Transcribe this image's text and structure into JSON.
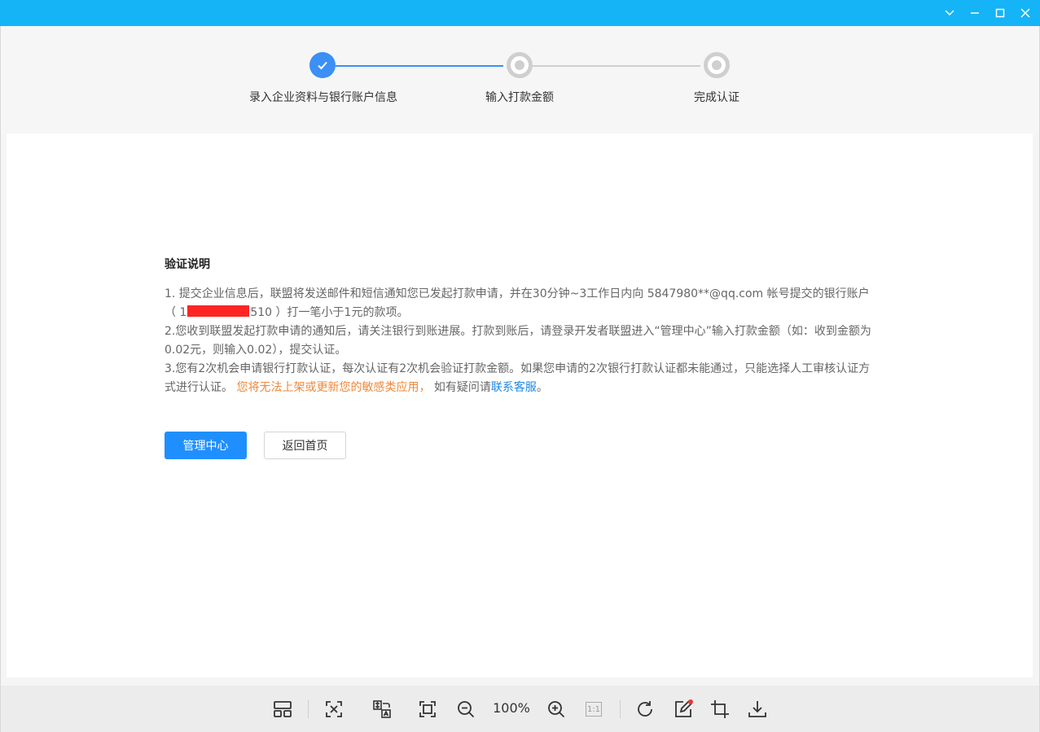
{
  "window": {
    "controls": [
      "chevron-down-icon",
      "minimize-icon",
      "maximize-icon",
      "close-icon"
    ],
    "accent_color": "#14b4f7"
  },
  "stepper": {
    "steps": [
      {
        "label": "录入企业资料与银行账户信息",
        "state": "done"
      },
      {
        "label": "输入打款金额",
        "state": "todo"
      },
      {
        "label": "完成认证",
        "state": "todo"
      }
    ],
    "active_color": "#3b8ff5"
  },
  "notice": {
    "title": "验证说明",
    "p1_a": "1. 提交企业信息后，联盟将发送邮件和短信通知您已发起打款申请，并在30分钟~3工作日内向 5847980**@qq.com 帐号提交的银行账户（ 1",
    "p1_b": "510 ）打一笔小于1元的款项。",
    "p2": "2.您收到联盟发起打款申请的通知后，请关注银行到账进展。打款到账后，请登录开发者联盟进入“管理中心”输入打款金额（如：收到金额为0.02元，则输入0.02），提交认证。",
    "p3_a": "3.您有2次机会申请银行打款认证，每次认证有2次机会验证打款金额。如果您申请的2次银行打款认证都未能通过，只能选择人工审核认证方式进行认证。 ",
    "p3_warn": "您将无法上架或更新您的敏感类应用，",
    "p3_b": " 如有疑问请",
    "p3_link": "联系客服",
    "p3_end": "。",
    "warn_color": "#f0883a",
    "link_color": "#1e88e5"
  },
  "buttons": {
    "primary": "管理中心",
    "secondary": "返回首页"
  },
  "toolbar": {
    "zoom": "100%",
    "one_to_one": "1:1",
    "icons": [
      "thumbnails-icon",
      "fit-screen-icon",
      "ocr-translate-icon",
      "fullscreen-icon",
      "zoom-out-icon",
      "zoom-in-icon",
      "actual-size-icon",
      "rotate-icon",
      "edit-icon",
      "crop-icon",
      "download-icon"
    ]
  }
}
